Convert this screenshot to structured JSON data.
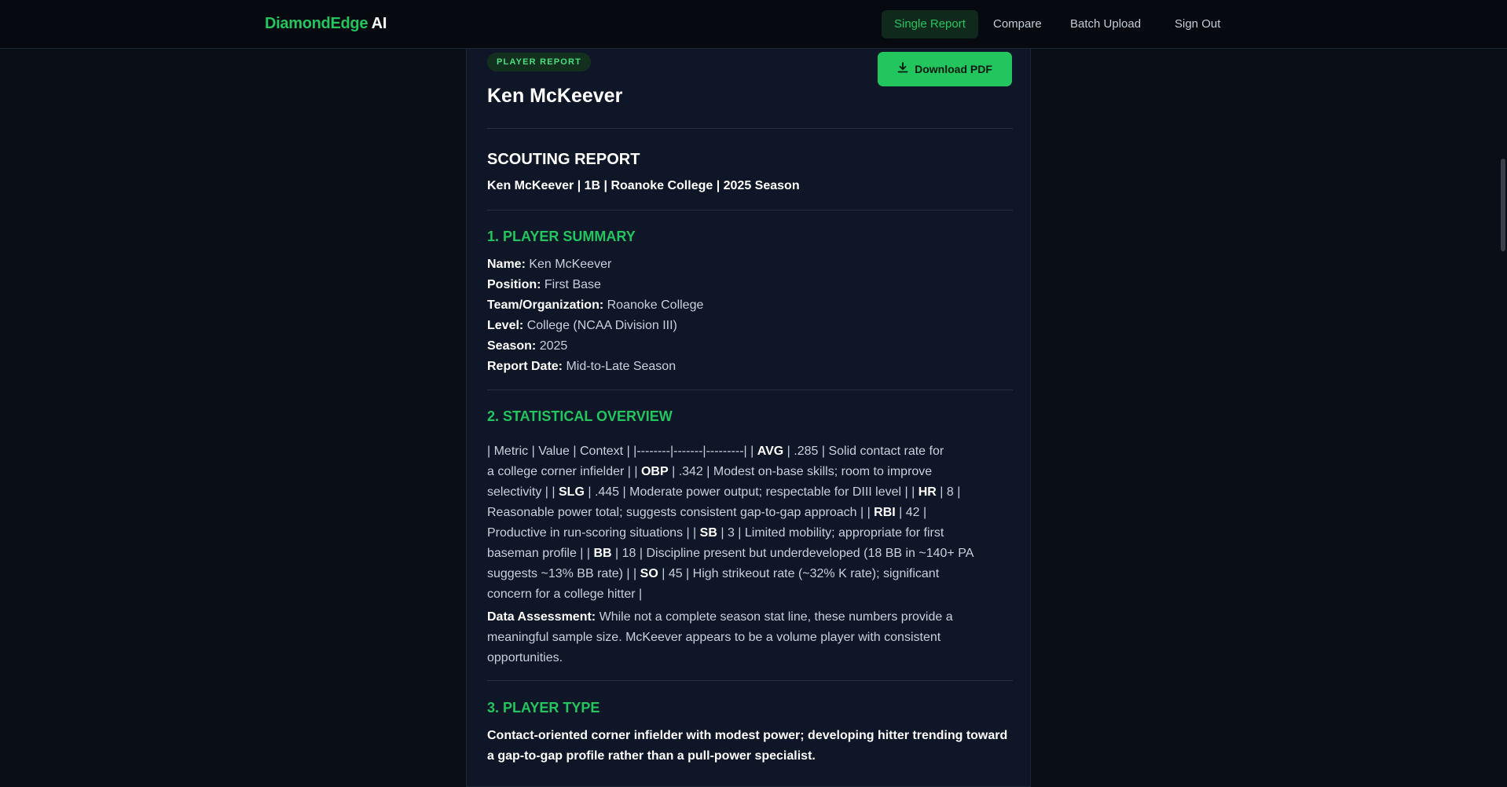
{
  "header": {
    "brand_green": "DiamondEdge",
    "brand_white": "AI",
    "nav": {
      "single_report": "Single Report",
      "compare": "Compare",
      "batch_upload": "Batch Upload",
      "sign_out": "Sign Out"
    }
  },
  "report": {
    "badge": "PLAYER REPORT",
    "download_label": "Download PDF",
    "player_name": "Ken McKeever",
    "heading": "SCOUTING REPORT",
    "subline": "Ken McKeever | 1B | Roanoke College | 2025 Season",
    "summary": {
      "title": "1. PLAYER SUMMARY",
      "name_label": "Name:",
      "name_value": "Ken McKeever",
      "position_label": "Position:",
      "position_value": "First Base",
      "team_label": "Team/Organization:",
      "team_value": "Roanoke College",
      "level_label": "Level:",
      "level_value": "College (NCAA Division III)",
      "season_label": "Season:",
      "season_value": "2025",
      "date_label": "Report Date:",
      "date_value": "Mid-to-Late Season"
    },
    "stats": {
      "title": "2. STATISTICAL OVERVIEW",
      "lines": [
        {
          "pre": "| Metric | Value | Context | |--------|-------|---------| | ",
          "bold": "AVG",
          "post": " | .285 | Solid contact rate for"
        },
        {
          "pre": "a college corner infielder | | ",
          "bold": "OBP",
          "post": " | .342 | Modest on-base skills; room to improve"
        },
        {
          "pre": "selectivity | | ",
          "bold": "SLG",
          "post": " | .445 | Moderate power output; respectable for DIII level | | ",
          "bold2": "HR",
          "post2": " | 8 |"
        },
        {
          "pre": "Reasonable power total; suggests consistent gap-to-gap approach | | ",
          "bold": "RBI",
          "post": " | 42 |"
        },
        {
          "pre": "Productive in run-scoring situations | | ",
          "bold": "SB",
          "post": " | 3 | Limited mobility; appropriate for first"
        },
        {
          "pre": "baseman profile | | ",
          "bold": "BB",
          "post": " | 18 | Discipline present but underdeveloped (18 BB in ~140+ PA"
        },
        {
          "pre": "suggests ~13% BB rate) | | ",
          "bold": "SO",
          "post": " | 45 | High strikeout rate (~32% K rate); significant"
        },
        {
          "pre": "concern for a college hitter |",
          "bold": "",
          "post": ""
        }
      ],
      "assessment_label": "Data Assessment:",
      "assessment_text": " While not a complete season stat line, these numbers provide a meaningful sample size. McKeever appears to be a volume player with consistent opportunities."
    },
    "player_type": {
      "title": "3. PLAYER TYPE",
      "text": "Contact-oriented corner infielder with modest power; developing hitter trending toward a gap-to-gap profile rather than a pull-power specialist."
    }
  },
  "colors": {
    "accent": "#22c55e",
    "background": "#0a0e17",
    "card": "#0e1628"
  }
}
